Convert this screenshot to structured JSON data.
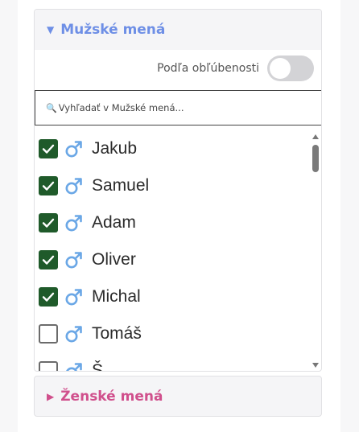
{
  "male_section": {
    "title": "Mužské mená",
    "caret": "▼",
    "sort_toggle_label": "Podľa obľúbenosti",
    "sort_toggle_on": false,
    "search_placeholder": "Vyhľadať v Mužské mená...",
    "search_icon": "magnifier-icon",
    "names": [
      {
        "name": "Jakub",
        "checked": true
      },
      {
        "name": "Samuel",
        "checked": true
      },
      {
        "name": "Adam",
        "checked": true
      },
      {
        "name": "Oliver",
        "checked": true
      },
      {
        "name": "Michal",
        "checked": true
      },
      {
        "name": "Tomáš",
        "checked": false
      },
      {
        "name": "Š...",
        "checked": false
      }
    ]
  },
  "female_section": {
    "title": "Ženské mená",
    "caret": "▶"
  },
  "colors": {
    "male_accent": "#6e8fe6",
    "female_accent": "#d04f8c",
    "checkbox_checked": "#1f5a2a",
    "male_symbol": "#6aa7e6"
  }
}
